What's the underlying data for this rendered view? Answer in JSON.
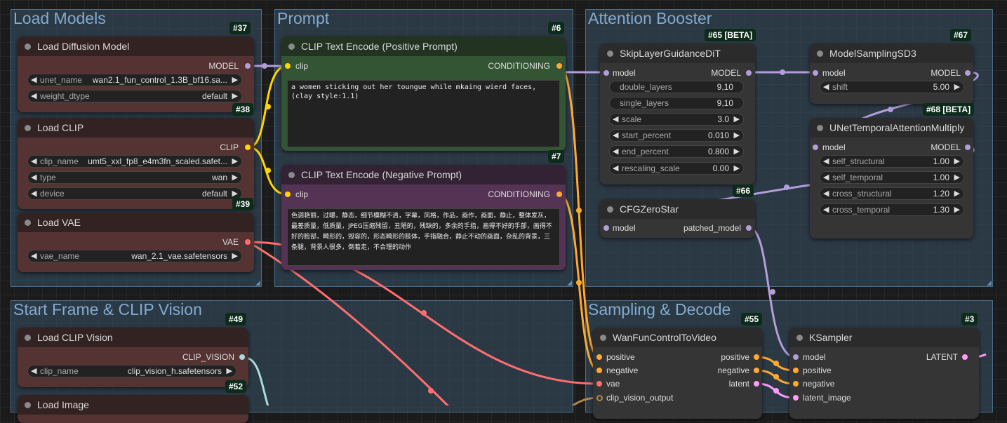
{
  "colors": {
    "model": "#b39ddb",
    "clip": "#ffd500",
    "conditioning": "#ffa931",
    "vae": "#ff6e6e",
    "clip_vision": "#a8dadc",
    "latent": "#ff9cf9",
    "generic": "#b0864d"
  },
  "groups": {
    "load_models": "Load Models",
    "prompt": "Prompt",
    "attention": "Attention Booster",
    "start_frame": "Start Frame & CLIP Vision",
    "sampling": "Sampling & Decode"
  },
  "nodes": {
    "load_diffusion": {
      "title": "Load Diffusion Model",
      "badge": "#37",
      "output": "MODEL",
      "widgets": [
        {
          "name": "unet_name",
          "value": "wan2.1_fun_control_1.3B_bf16.sa..."
        },
        {
          "name": "weight_dtype",
          "value": "default"
        }
      ]
    },
    "load_clip": {
      "title": "Load CLIP",
      "badge": "#38",
      "output": "CLIP",
      "widgets": [
        {
          "name": "clip_name",
          "value": "umt5_xxl_fp8_e4m3fn_scaled.safet..."
        },
        {
          "name": "type",
          "value": "wan"
        },
        {
          "name": "device",
          "value": "default"
        }
      ]
    },
    "load_vae": {
      "title": "Load VAE",
      "badge": "#39",
      "output": "VAE",
      "widgets": [
        {
          "name": "vae_name",
          "value": "wan_2.1_vae.safetensors"
        }
      ]
    },
    "clip_pos": {
      "title": "CLIP Text Encode (Positive Prompt)",
      "badge": "#6",
      "input": "clip",
      "output": "CONDITIONING",
      "text": "a women sticking out her toungue while mkaing wierd faces,(clay style:1.1)"
    },
    "clip_neg": {
      "title": "CLIP Text Encode (Negative Prompt)",
      "badge": "#7",
      "input": "clip",
      "output": "CONDITIONING",
      "text": "色调艳丽，过曝，静态，细节模糊不清，字幕，风格，作品，画作，画面，静止，整体发灰，最差质量，低质量，JPEG压缩残留，丑陋的，残缺的，多余的手指，画得不好的手部，画得不好的脸部，畸形的，毁容的，形态畸形的肢体，手指融合，静止不动的画面，杂乱的背景，三条腿，背景人很多，倒着走，不合理的动作"
    },
    "skip_layer": {
      "title": "SkipLayerGuidanceDiT",
      "badge": "#65 [BETA]",
      "input": "model",
      "output": "MODEL",
      "widgets": [
        {
          "name": "double_layers",
          "value": "9,10",
          "plain": true
        },
        {
          "name": "single_layers",
          "value": "9,10",
          "plain": true
        },
        {
          "name": "scale",
          "value": "3.0"
        },
        {
          "name": "start_percent",
          "value": "0.010"
        },
        {
          "name": "end_percent",
          "value": "0.800"
        },
        {
          "name": "rescaling_scale",
          "value": "0.00"
        }
      ]
    },
    "model_sampling": {
      "title": "ModelSamplingSD3",
      "badge": "#67",
      "input": "model",
      "output": "MODEL",
      "widgets": [
        {
          "name": "shift",
          "value": "5.00"
        }
      ]
    },
    "unet_temporal": {
      "title": "UNetTemporalAttentionMultiply",
      "badge": "#68 [BETA]",
      "input": "model",
      "output": "MODEL",
      "widgets": [
        {
          "name": "self_structural",
          "value": "1.00"
        },
        {
          "name": "self_temporal",
          "value": "1.00"
        },
        {
          "name": "cross_structural",
          "value": "1.20"
        },
        {
          "name": "cross_temporal",
          "value": "1.30"
        }
      ]
    },
    "cfg_zero": {
      "title": "CFGZeroStar",
      "badge": "#66",
      "input": "model",
      "output": "patched_model"
    },
    "load_clip_vision": {
      "title": "Load CLIP Vision",
      "badge": "#49",
      "output": "CLIP_VISION",
      "widgets": [
        {
          "name": "clip_name",
          "value": "clip_vision_h.safetensors"
        }
      ]
    },
    "load_image": {
      "title": "Load Image",
      "badge": "#52"
    },
    "wan_fun": {
      "title": "WanFunControlToVideo",
      "badge": "#55",
      "inputs": [
        "positive",
        "negative",
        "vae",
        "clip_vision_output"
      ],
      "outputs": [
        "positive",
        "negative",
        "latent"
      ]
    },
    "ksampler": {
      "title": "KSampler",
      "badge": "#3",
      "inputs": [
        "model",
        "positive",
        "negative",
        "latent_image"
      ],
      "output": "LATENT"
    }
  }
}
